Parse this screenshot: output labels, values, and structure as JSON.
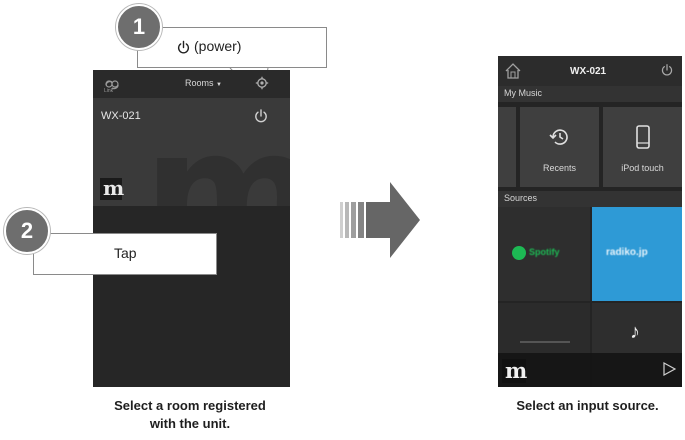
{
  "step1": {
    "badge": "1",
    "callout": "(power)",
    "icon": "power-icon"
  },
  "step2": {
    "badge": "2",
    "callout": "Tap"
  },
  "left_screen": {
    "top_bar": {
      "link_icon": "link-icon",
      "link_label": "Link",
      "rooms_label": "Rooms",
      "rooms_dropdown_icon": "chevron-down-icon",
      "settings_icon": "gear-icon"
    },
    "room": {
      "name": "WX-021",
      "power_icon": "power-icon",
      "thumbnail_letter": "m"
    },
    "caption_line1": "Select a room registered",
    "caption_line2": "with the unit."
  },
  "right_screen": {
    "top_bar": {
      "home_icon": "home-icon",
      "title": "WX-021",
      "power_icon": "power-icon"
    },
    "my_music": {
      "header": "My Music",
      "tiles": [
        {
          "label": "Recents",
          "icon": "history-icon"
        },
        {
          "label": "iPod touch",
          "icon": "ipod-icon"
        }
      ]
    },
    "sources": {
      "header": "Sources",
      "tiles": [
        {
          "label": "Spotify",
          "color": "#1db954"
        },
        {
          "label": "radiko.jp",
          "color": "#2e9ad6"
        },
        {
          "label": "",
          "color": "#2b2b2b"
        },
        {
          "label": "",
          "icon": "music-note-icon"
        }
      ]
    },
    "bottom_bar": {
      "thumbnail_letter": "m",
      "play_icon": "play-icon"
    },
    "caption": "Select an input source."
  },
  "colors": {
    "badge": "#6e6e6e",
    "app_background": "#252525",
    "radiko": "#2e9ad6",
    "spotify": "#1db954"
  }
}
